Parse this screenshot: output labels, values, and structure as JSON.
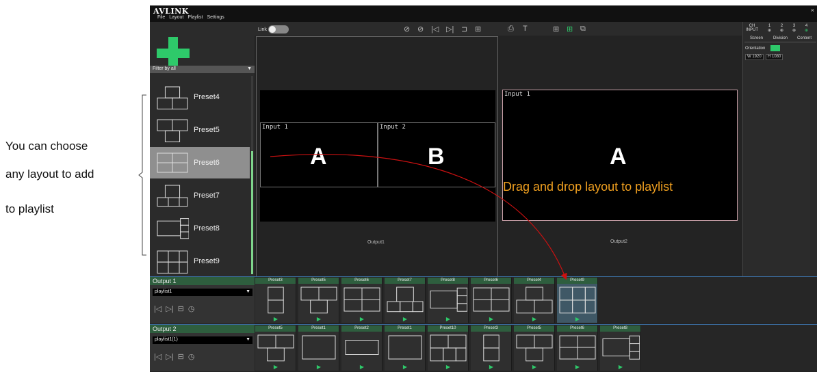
{
  "annotation": {
    "lines": [
      "You can choose",
      "any layout to add",
      "to playlist"
    ]
  },
  "app": {
    "logo": "AVLINK",
    "menu": [
      "File",
      "Layout",
      "Playlist",
      "Settings"
    ],
    "close": "×"
  },
  "left_panel": {
    "filter_label": "Filter by all",
    "presets": [
      {
        "label": "Preset4",
        "selected": false,
        "layout": "3-top1"
      },
      {
        "label": "Preset5",
        "selected": false,
        "layout": "3-top2"
      },
      {
        "label": "Preset6",
        "selected": true,
        "layout": "quad"
      },
      {
        "label": "Preset7",
        "selected": false,
        "layout": "top1-bottom3"
      },
      {
        "label": "Preset8",
        "selected": false,
        "layout": "big-right3"
      },
      {
        "label": "Preset9",
        "selected": false,
        "layout": "top3-bottom3"
      }
    ]
  },
  "toolbar": {
    "link_label": "Link",
    "icons": [
      "eye-slash-icon",
      "eye-slash-alt-icon",
      "prev-icon",
      "next-icon",
      "fit-icon",
      "grid-icon",
      "snapshot-icon",
      "text-icon",
      "layout-grid-icon",
      "layout-add-icon",
      "layout-copy-icon"
    ]
  },
  "output1": {
    "label": "Output1",
    "windows": [
      {
        "title": "Input 1",
        "letter": "A"
      },
      {
        "title": "Input 2",
        "letter": "B"
      }
    ]
  },
  "output2": {
    "label": "Output2",
    "windows": [
      {
        "title": "Input 1",
        "letter": "A"
      }
    ],
    "drag_hint": "Drag and drop layout to playlist"
  },
  "right_panel": {
    "ch_label": "CH",
    "input_label": "INPUT",
    "channels": [
      "1",
      "2",
      "3",
      "4"
    ],
    "tabs": [
      "Screen",
      "Division",
      "Content"
    ],
    "orientation_label": "Orientation",
    "width": "W 1920",
    "height": "H 1080"
  },
  "playlists": [
    {
      "title": "Output 1",
      "playlist": "playlist1",
      "cards": [
        {
          "name": "Preset3",
          "layout": "top1-bottom1",
          "selected": false
        },
        {
          "name": "Preset5",
          "layout": "3-top2",
          "selected": false
        },
        {
          "name": "Preset6",
          "layout": "quad",
          "selected": false
        },
        {
          "name": "Preset7",
          "layout": "top1-bottom3",
          "selected": false
        },
        {
          "name": "Preset8",
          "layout": "big-right3",
          "selected": false
        },
        {
          "name": "Preset6",
          "layout": "quad",
          "selected": false
        },
        {
          "name": "Preset4",
          "layout": "3-top1",
          "selected": false
        },
        {
          "name": "Preset9",
          "layout": "top3-bottom3",
          "selected": true
        }
      ]
    },
    {
      "title": "Output 2",
      "playlist": "playlist1(1)",
      "cards": [
        {
          "name": "Preset5",
          "layout": "3-top2",
          "selected": false
        },
        {
          "name": "Preset1",
          "layout": "single",
          "selected": false
        },
        {
          "name": "Preset2",
          "layout": "center-strip",
          "selected": false
        },
        {
          "name": "Preset1",
          "layout": "single",
          "selected": false
        },
        {
          "name": "Preset10",
          "layout": "top2-bottom3",
          "selected": false
        },
        {
          "name": "Preset3",
          "layout": "top1-bottom1",
          "selected": false
        },
        {
          "name": "Preset5",
          "layout": "3-top2",
          "selected": false
        },
        {
          "name": "Preset6",
          "layout": "quad",
          "selected": false
        },
        {
          "name": "Preset8",
          "layout": "big-right3",
          "selected": false
        }
      ]
    }
  ],
  "colors": {
    "accent_green": "#2ec96a",
    "drag_text": "#f0a020",
    "arrow": "#cc1111"
  }
}
